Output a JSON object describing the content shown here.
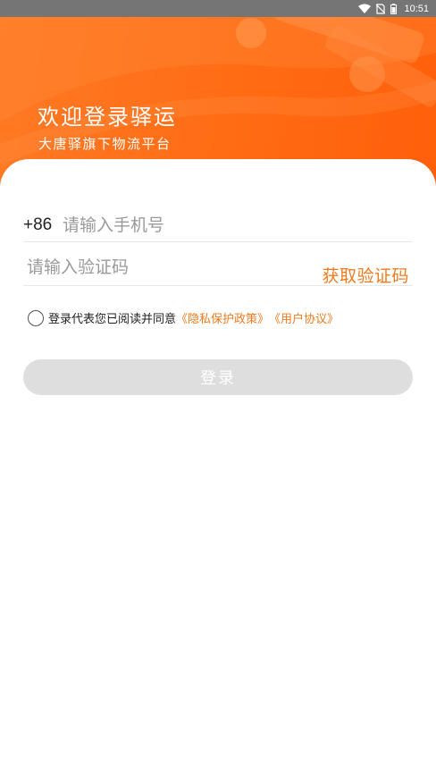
{
  "status_bar": {
    "time": "10:51",
    "icons": [
      "wifi-icon",
      "no-sim-icon",
      "battery-icon"
    ]
  },
  "header": {
    "title": "欢迎登录驿运",
    "subtitle": "大唐驿旗下物流平台"
  },
  "login_form": {
    "country_code": "+86",
    "phone_placeholder": "请输入手机号",
    "phone_value": "",
    "code_placeholder": "请输入验证码",
    "code_value": "",
    "get_code_label": "获取验证码",
    "agreement_text": "登录代表您已阅读并同意",
    "privacy_link": "《隐私保护政策》",
    "user_agreement_link": "《用户协议》",
    "agree_checked": false,
    "login_label": "登录"
  },
  "colors": {
    "accent": "#f07a1e",
    "header_gradient_start": "#ff7a24",
    "header_gradient_end": "#ff5f0a",
    "button_disabled": "#dedede"
  }
}
